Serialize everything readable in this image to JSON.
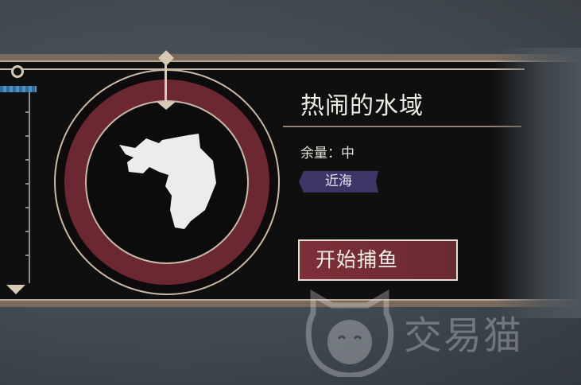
{
  "area": {
    "title": "热闹的水域",
    "remaining_label": "余量：中",
    "zone_tag": "近海"
  },
  "actions": {
    "start_fishing": "开始捕鱼"
  },
  "watermark": {
    "text": "交易猫"
  },
  "icons": {
    "region_map": "island-silhouette-icon",
    "depth_marker": "triangle-marker-icon",
    "watermark_logo": "cat-face-logo"
  },
  "colors": {
    "panel_bg": "#0f0f0f",
    "ring_red": "#6b2830",
    "frame_beige": "#d8c8b6",
    "tag_purple": "#3c3566",
    "button_red": "#7e2f38"
  }
}
